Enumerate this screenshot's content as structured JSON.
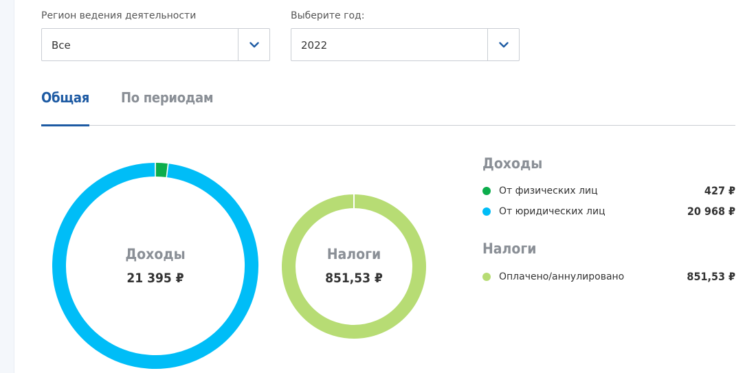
{
  "filters": {
    "region": {
      "label": "Регион ведения деятельности",
      "value": "Все"
    },
    "year": {
      "label": "Выберите год:",
      "value": "2022"
    }
  },
  "tabs": [
    {
      "label": "Общая",
      "active": true
    },
    {
      "label": "По периодам",
      "active": false
    }
  ],
  "income": {
    "title": "Доходы",
    "total": "21 395 ₽",
    "items": [
      {
        "label": "От физических лиц",
        "value": "427 ₽",
        "amount": 427,
        "color": "#0cad4c"
      },
      {
        "label": "От юридических лиц",
        "value": "20 968 ₽",
        "amount": 20968,
        "color": "#00bdf7"
      }
    ]
  },
  "taxes": {
    "title": "Налоги",
    "total": "851,53 ₽",
    "items": [
      {
        "label": "Оплачено/аннулировано",
        "value": "851,53 ₽",
        "amount": 851.53,
        "color": "#b7dc74"
      }
    ]
  },
  "icons": {
    "dropdown": "chevron-down-icon"
  },
  "colors": {
    "accent": "#1d5aa3",
    "chevron": "#1d5aa3"
  }
}
